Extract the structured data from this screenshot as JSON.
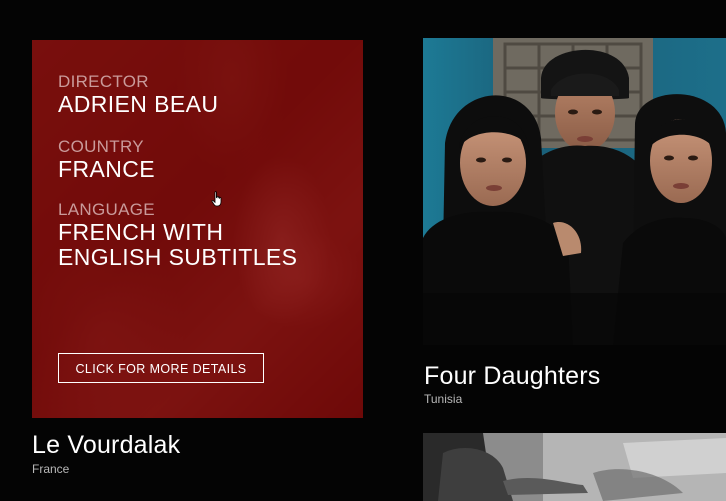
{
  "films": [
    {
      "title": "Le Vourdalak",
      "country": "France",
      "details": {
        "director_label": "DIRECTOR",
        "director_value": "ADRIEN BEAU",
        "country_label": "COUNTRY",
        "country_value": "FRANCE",
        "language_label": "LANGUAGE",
        "language_line1": "FRENCH WITH",
        "language_line2": "ENGLISH SUBTITLES",
        "button_label": "CLICK FOR MORE DETAILS"
      },
      "overlay_color": "#8a0a0a"
    },
    {
      "title": "Four Daughters",
      "country": "Tunisia"
    }
  ],
  "icons": {
    "cursor": "hand-pointer-icon"
  }
}
